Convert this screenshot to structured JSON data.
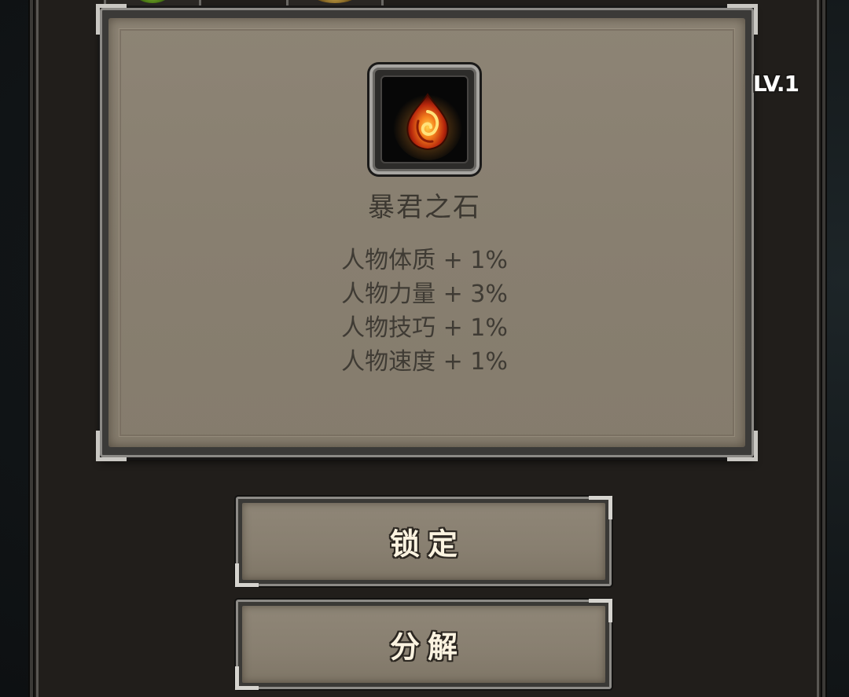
{
  "item": {
    "level": "LV.1",
    "name": "暴君之石",
    "icon": "fire-rune-stone-icon",
    "stats": [
      "人物体质 + 1%",
      "人物力量 + 3%",
      "人物技巧 + 1%",
      "人物速度 + 1%"
    ]
  },
  "actions": {
    "lock_label": "锁定",
    "decompose_label": "分解"
  },
  "colors": {
    "panel": "#8b8273",
    "frame": "#211e1b",
    "text": "#3f3b34",
    "button_text": "#fbf3e0"
  }
}
